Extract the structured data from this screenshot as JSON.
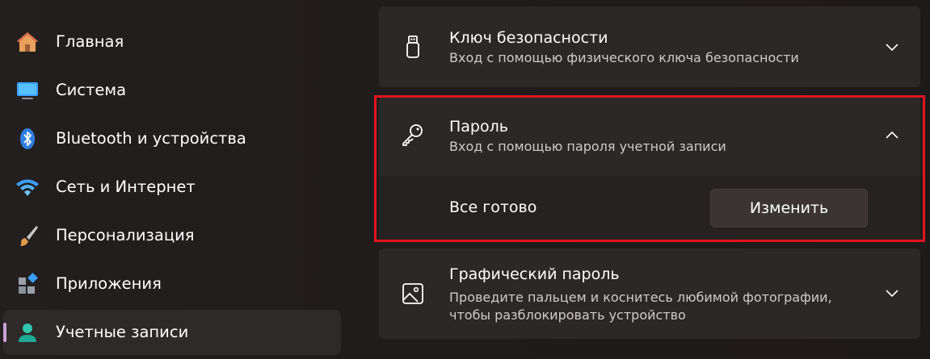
{
  "sidebar": {
    "items": [
      {
        "label": "Главная",
        "icon": "home-icon"
      },
      {
        "label": "Система",
        "icon": "monitor-icon"
      },
      {
        "label": "Bluetooth и устройства",
        "icon": "bluetooth-icon"
      },
      {
        "label": "Сеть и Интернет",
        "icon": "wifi-icon"
      },
      {
        "label": "Персонализация",
        "icon": "brush-icon"
      },
      {
        "label": "Приложения",
        "icon": "apps-icon"
      },
      {
        "label": "Учетные записи",
        "icon": "account-icon",
        "selected": true
      }
    ]
  },
  "main": {
    "security_key": {
      "title": "Ключ безопасности",
      "subtitle": "Вход с помощью физического ключа безопасности"
    },
    "password": {
      "title": "Пароль",
      "subtitle": "Вход с помощью пароля учетной записи",
      "status": "Все готово",
      "button": "Изменить"
    },
    "picture_password": {
      "title": "Графический пароль",
      "subtitle_line1": "Проведите пальцем и коснитесь любимой фотографии,",
      "subtitle_line2": "чтобы разблокировать устройство"
    }
  },
  "colors": {
    "highlight": "#e0151f",
    "selected_indicator": "#c8a2d6",
    "accent_blue": "#3aa0ff"
  }
}
